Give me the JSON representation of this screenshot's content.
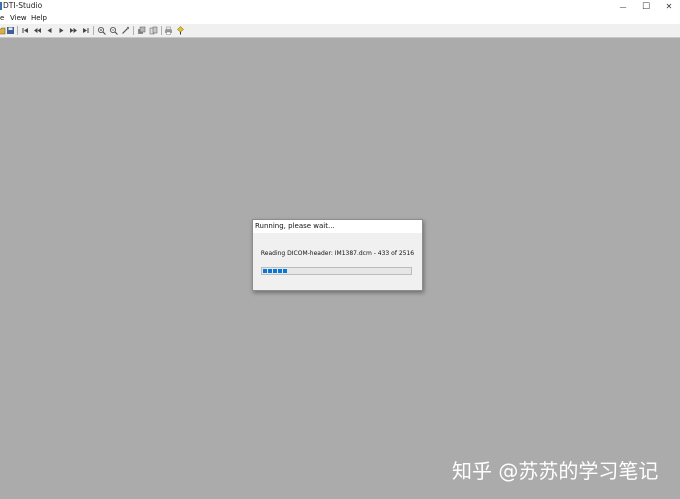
{
  "window": {
    "title": "DTI-Studio",
    "minimize_glyph": "—",
    "maximize_glyph": "☐",
    "close_glyph": "✕"
  },
  "menu": [
    "e",
    "View",
    "Help"
  ],
  "toolbar": {
    "icons": [
      "open-icon",
      "save-icon",
      "first-frame-icon",
      "rewind-icon",
      "step-back-icon",
      "play-icon",
      "step-forward-icon",
      "last-frame-icon",
      "zoom-in-icon",
      "zoom-out-icon",
      "tool-icon",
      "layers-icon",
      "copy-icon",
      "print-icon",
      "help-icon"
    ]
  },
  "dialog": {
    "title": "Running, please wait...",
    "status": "Reading DICOM-header:  IM1387.dcm - 433 of 2516",
    "progress_fraction": 0.172,
    "progress_color": "#0a78d7"
  },
  "watermark": "知乎 @苏苏的学习笔记",
  "colors": {
    "desktop": "#ababab",
    "toolbar": "#f0f0f0",
    "dialog": "#f0f0f0"
  }
}
